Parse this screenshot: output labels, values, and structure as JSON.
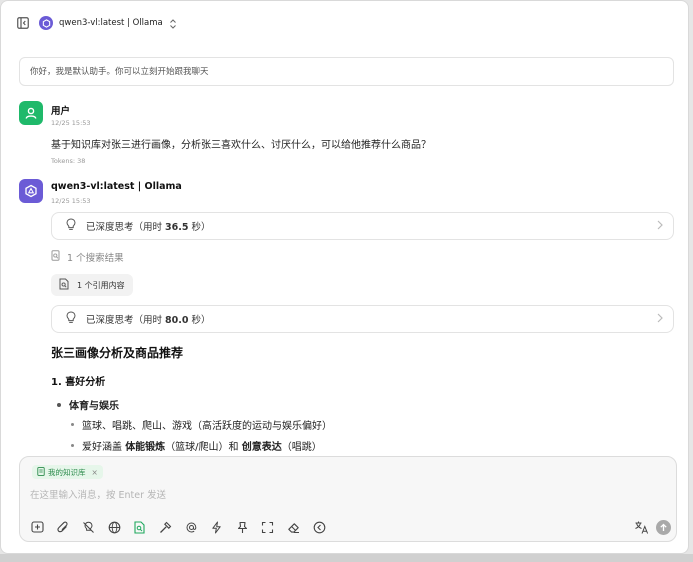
{
  "header": {
    "model_name": "qwen3-vl:latest | Ollama",
    "toggle_icon": "sidebar-toggle-icon",
    "chevron_icon": "chevron-updown-icon"
  },
  "greeting": "你好，我是默认助手。你可以立刻开始跟我聊天",
  "user_message": {
    "sender": "用户",
    "time": "12/25 15:53",
    "text": "基于知识库对张三进行画像，分析张三喜欢什么、讨厌什么，可以给他推荐什么商品？",
    "tokens": "Tokens: 38"
  },
  "assistant_message": {
    "sender": "qwen3-vl:latest | Ollama",
    "time": "12/25 15:53",
    "think1_prefix": "已深度思考（用时",
    "think1_time": "36.5",
    "think1_unit": "秒）",
    "search_results": "1 个搜索结果",
    "reference_chip": "1 个引用内容",
    "think2_prefix": "已深度思考（用时",
    "think2_time": "80.0",
    "think2_unit": "秒）",
    "heading": "张三画像分析及商品推荐",
    "section1": "1. 喜好分析",
    "bullet1": "体育与娱乐",
    "sub1": "篮球、唱跳、爬山、游戏（高活跃度的运动与娱乐偏好）",
    "sub2_a": "爱好涵盖",
    "sub2_b": "体能锻炼",
    "sub2_c": "（篮球/爬山）和",
    "sub2_d": "创意表达",
    "sub2_e": "（唱跳）"
  },
  "composer": {
    "kb_chip": "我的知识库",
    "kb_close": "×",
    "placeholder": "在这里输入消息，按 Enter 发送"
  },
  "colors": {
    "accent_green": "#1fb96a",
    "accent_purple": "#6b5bd6"
  }
}
